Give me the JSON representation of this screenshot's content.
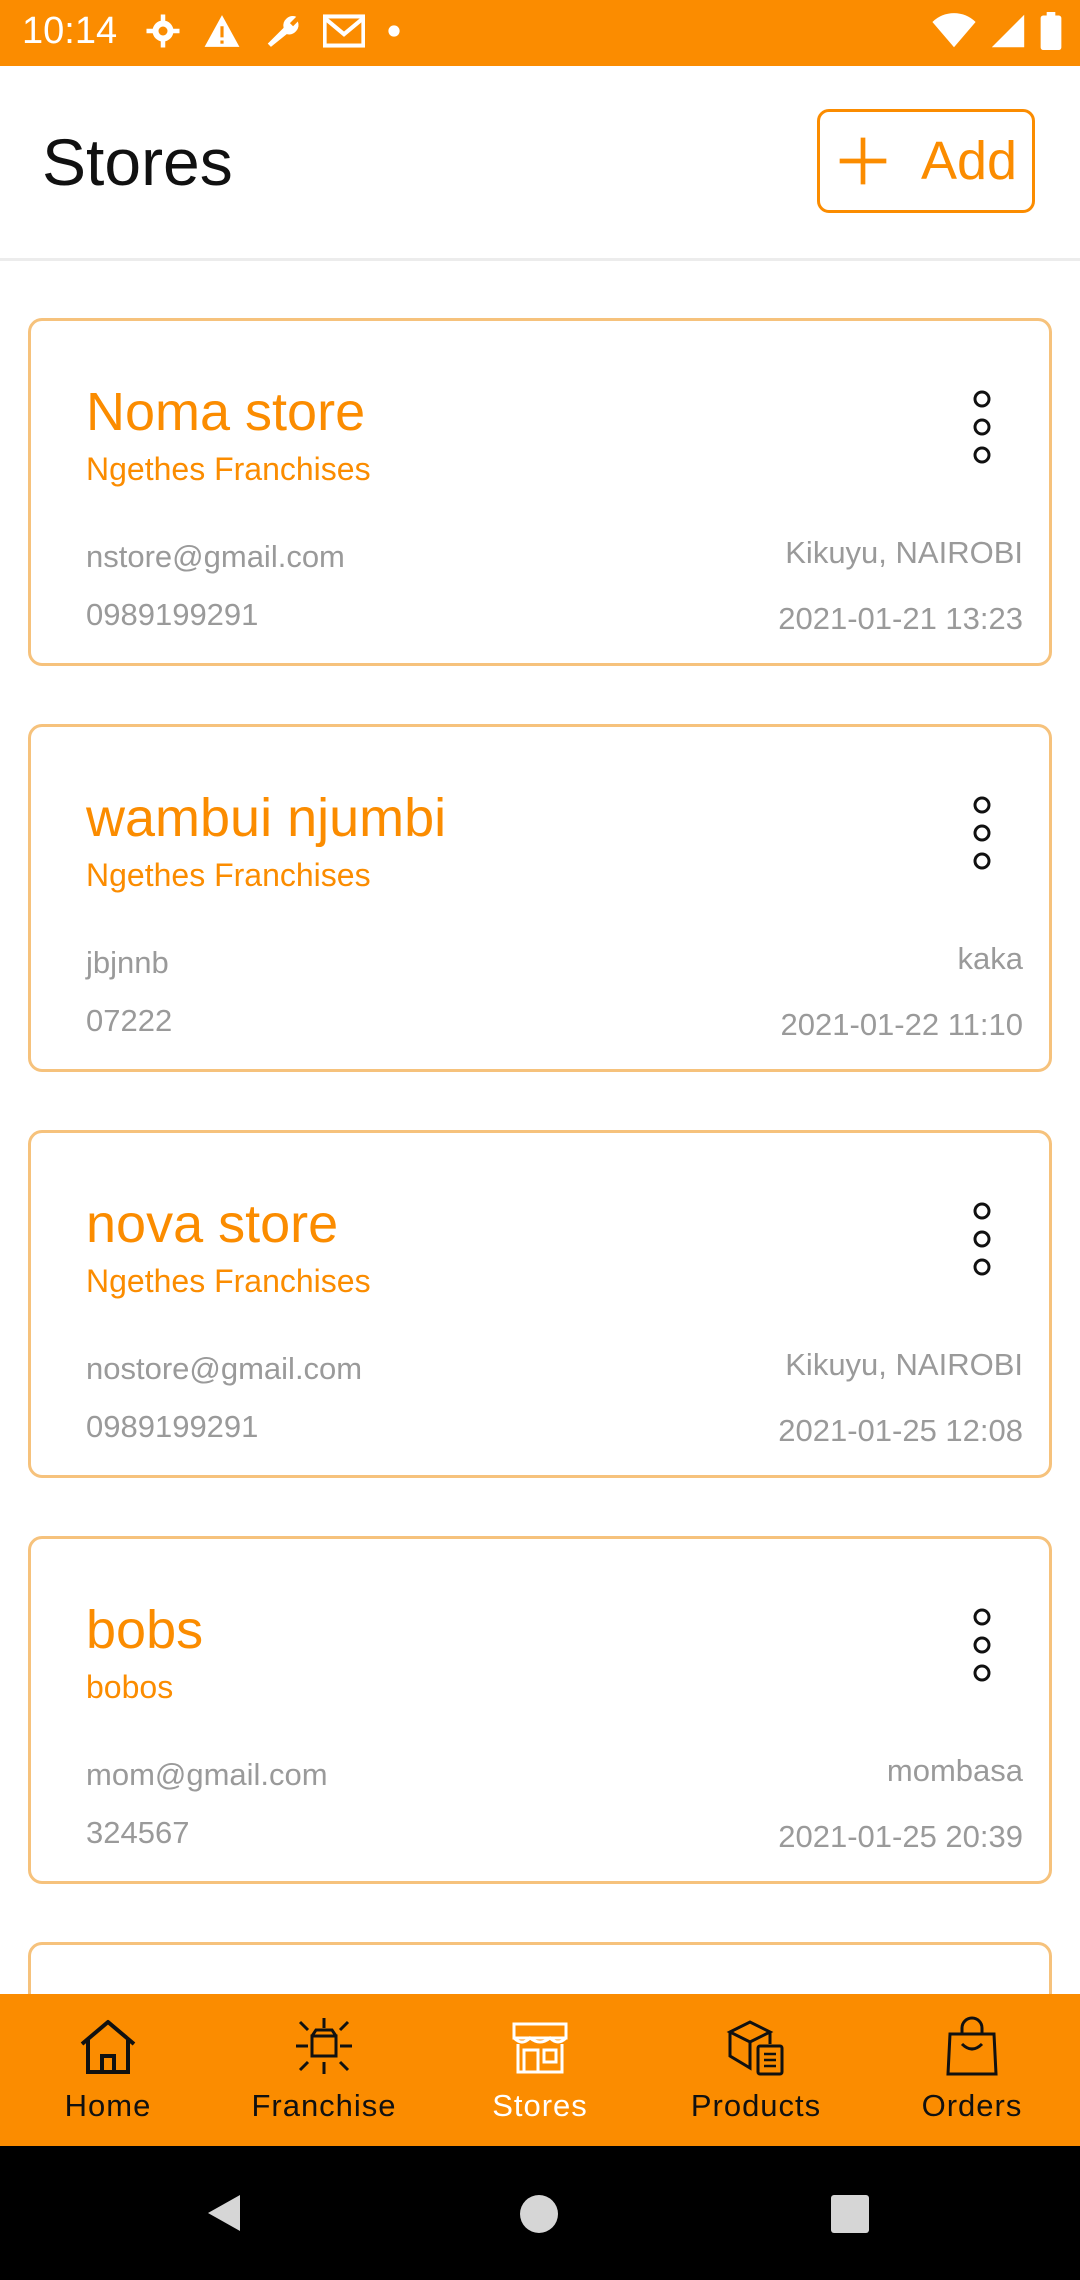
{
  "status_bar": {
    "time": "10:14",
    "left_icons": [
      "settings-icon",
      "alert-icon",
      "wrench-icon",
      "gmail-icon",
      "dot-icon"
    ],
    "right_icons": [
      "wifi-icon",
      "signal-icon",
      "battery-icon"
    ]
  },
  "header": {
    "title": "Stores",
    "add_label": "Add"
  },
  "stores": [
    {
      "name": "Noma store",
      "franchise": "Ngethes Franchises",
      "email": "nstore@gmail.com",
      "phone": "0989199291",
      "location": "Kikuyu, NAIROBI",
      "date": "2021-01-21 13:23"
    },
    {
      "name": "wambui njumbi",
      "franchise": "Ngethes Franchises",
      "email": "jbjnnb",
      "phone": "07222",
      "location": "kaka",
      "date": "2021-01-22 11:10"
    },
    {
      "name": "nova store",
      "franchise": "Ngethes Franchises",
      "email": "nostore@gmail.com",
      "phone": "0989199291",
      "location": "Kikuyu, NAIROBI",
      "date": "2021-01-25 12:08"
    },
    {
      "name": "bobs",
      "franchise": "bobos",
      "email": "mom@gmail.com",
      "phone": "324567",
      "location": "mombasa",
      "date": "2021-01-25 20:39"
    }
  ],
  "bottom_nav": {
    "items": [
      {
        "label": "Home",
        "icon": "home-icon"
      },
      {
        "label": "Franchise",
        "icon": "franchise-icon"
      },
      {
        "label": "Stores",
        "icon": "store-icon",
        "active": true
      },
      {
        "label": "Products",
        "icon": "products-icon"
      },
      {
        "label": "Orders",
        "icon": "orders-icon"
      }
    ]
  },
  "colors": {
    "accent": "#fb8c00",
    "card_border": "#f6c27c",
    "secondary_text": "#9a9a9a"
  }
}
